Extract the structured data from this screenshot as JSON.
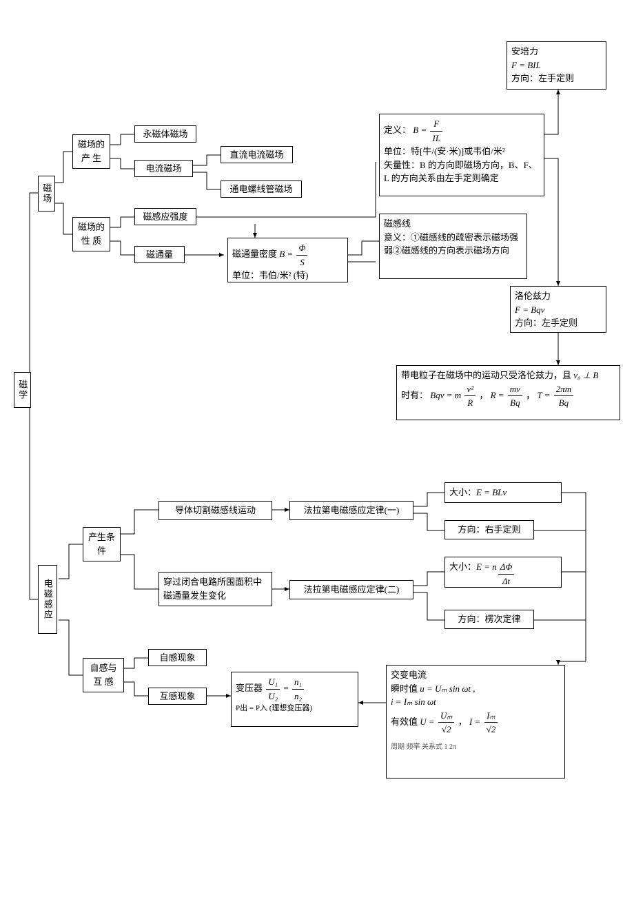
{
  "root": {
    "label": "磁学"
  },
  "magnetism": {
    "label": "磁场",
    "production": {
      "label": "磁场的产 生",
      "permanent": "永磁体磁场",
      "current": "电流磁场",
      "dc": "直流电流磁场",
      "solenoid": "通电螺线管磁场"
    },
    "properties": {
      "label": "磁场的性 质",
      "intensity": "磁感应强度",
      "flux": "磁通量",
      "flux_density": {
        "prefix": "磁通量密度 ",
        "eq_left": "B = ",
        "num": "Φ",
        "den": "S",
        "unit": "单位：韦伯/米² (特)"
      },
      "definition": {
        "prefix": "定义：",
        "eq_left": "B = ",
        "num": "F",
        "den": "IL",
        "unit": "单位：特[牛/(安·米)]或韦伯/米²",
        "vector": "矢量性：B 的方向即磁场方向，B、F、L 的方向关系由左手定则确定"
      },
      "fieldlines": {
        "title": "磁感线",
        "meaning": "意义：①磁感线的疏密表示磁场强弱②磁感线的方向表示磁场方向"
      }
    },
    "ampere": {
      "title": "安培力",
      "eq": "F = BIL",
      "direction": "方向：左手定则"
    },
    "lorentz": {
      "title": "洛伦兹力",
      "eq": "F = Bqv",
      "direction": "方向：左手定则"
    },
    "charged": {
      "prefix": "带电粒子在磁场中的运动只受洛伦兹力，且 ",
      "v0": "v₀ ⊥ B",
      "when": "时有：",
      "eq1_left": "Bqv = m",
      "eq1_num": "v²",
      "eq1_den": "R",
      "eq2_left": "R = ",
      "eq2_num": "mv",
      "eq2_den": "Bq",
      "eq3_left": "T = ",
      "eq3_num": "2πm",
      "eq3_den": "Bq"
    }
  },
  "induction": {
    "label": "电磁感应",
    "conditions": {
      "label": "产生条件",
      "cutting": "导体切割磁感线运动",
      "flux_change": "穿过闭合电路所围面积中磁通量发生变化",
      "faraday1": "法拉第电磁感应定律(一)",
      "faraday2": "法拉第电磁感应定律(二)",
      "mag1": {
        "label": "大小：",
        "eq": "E = BLv"
      },
      "dir1": "方向：右手定则",
      "mag2": {
        "label": "大小：",
        "eq_left": "E = n",
        "num": "ΔΦ",
        "den": "Δt"
      },
      "dir2": "方向：楞次定律"
    },
    "self_mutual": {
      "label": "自感与互 感",
      "self": "自感现象",
      "mutual": "互感现象",
      "transformer": {
        "prefix": "变压器 ",
        "num1": "U₁",
        "den1": "U₂",
        "eq": " = ",
        "num2": "n₁",
        "den2": "n₂",
        "power": "P出 = P入 (理想变压器)"
      }
    },
    "ac": {
      "title": "交变电流",
      "inst_label": "瞬时值  ",
      "inst_u": "u = Uₘ sin ωt ,",
      "inst_i": "i = Iₘ sin ωt",
      "rms_label": "有效值  ",
      "rms_u_left": "U = ",
      "rms_u_num": "Uₘ",
      "rms_u_den": "√2",
      "rms_i_left": "I = ",
      "rms_i_num": "Iₘ",
      "rms_i_den": "√2",
      "bottom": "周期  频率  关系式  1  2π"
    }
  },
  "chart_data": {
    "type": "diagram",
    "description": "Concept map of 磁学 (Magnetism) branching into 磁场 (Magnetic Field) and 电磁感应 (Electromagnetic Induction)",
    "nodes": [
      {
        "id": "root",
        "label": "磁学"
      },
      {
        "id": "field",
        "label": "磁场"
      },
      {
        "id": "field_prod",
        "label": "磁场的产生"
      },
      {
        "id": "permanent",
        "label": "永磁体磁场"
      },
      {
        "id": "current",
        "label": "电流磁场"
      },
      {
        "id": "dc",
        "label": "直流电流磁场"
      },
      {
        "id": "solenoid",
        "label": "通电螺线管磁场"
      },
      {
        "id": "field_prop",
        "label": "磁场的性质"
      },
      {
        "id": "intensity",
        "label": "磁感应强度"
      },
      {
        "id": "flux",
        "label": "磁通量"
      },
      {
        "id": "flux_density",
        "label": "磁通量密度 B=Φ/S 单位:韦伯/米²(特)"
      },
      {
        "id": "definition",
        "label": "定义 B=F/IL 单位:特[牛/(安·米)]或韦伯/米² 矢量性:B的方向即磁场方向,B、F、L的方向关系由左手定则确定"
      },
      {
        "id": "fieldlines",
        "label": "磁感线 意义:①磁感线的疏密表示磁场强弱②磁感线的方向表示磁场方向"
      },
      {
        "id": "ampere",
        "label": "安培力 F=BIL 方向:左手定则"
      },
      {
        "id": "lorentz",
        "label": "洛伦兹力 F=Bqv 方向:左手定则"
      },
      {
        "id": "charged",
        "label": "带电粒子在磁场中的运动只受洛伦兹力,且v₀⊥B时有: Bqv=mv²/R, R=mv/Bq, T=2πm/Bq"
      },
      {
        "id": "induction",
        "label": "电磁感应"
      },
      {
        "id": "conditions",
        "label": "产生条件"
      },
      {
        "id": "cutting",
        "label": "导体切割磁感线运动"
      },
      {
        "id": "faraday1",
        "label": "法拉第电磁感应定律(一)"
      },
      {
        "id": "mag1",
        "label": "大小: E=BLv"
      },
      {
        "id": "dir1",
        "label": "方向:右手定则"
      },
      {
        "id": "flux_change",
        "label": "穿过闭合电路所围面积中磁通量发生变化"
      },
      {
        "id": "faraday2",
        "label": "法拉第电磁感应定律(二)"
      },
      {
        "id": "mag2",
        "label": "大小: E=nΔΦ/Δt"
      },
      {
        "id": "dir2",
        "label": "方向:楞次定律"
      },
      {
        "id": "self_mutual",
        "label": "自感与互感"
      },
      {
        "id": "self",
        "label": "自感现象"
      },
      {
        "id": "mutual",
        "label": "互感现象"
      },
      {
        "id": "transformer",
        "label": "变压器 U₁/U₂=n₁/n₂ P出=P入(理想变压器)"
      },
      {
        "id": "ac",
        "label": "交变电流 瞬时值 u=Uₘsinωt, i=Iₘsinωt 有效值 U=Uₘ/√2, I=Iₘ/√2"
      }
    ],
    "edges": [
      [
        "root",
        "field"
      ],
      [
        "root",
        "induction"
      ],
      [
        "field",
        "field_prod"
      ],
      [
        "field",
        "field_prop"
      ],
      [
        "field_prod",
        "permanent"
      ],
      [
        "field_prod",
        "current"
      ],
      [
        "current",
        "dc"
      ],
      [
        "current",
        "solenoid"
      ],
      [
        "field_prop",
        "intensity"
      ],
      [
        "field_prop",
        "flux"
      ],
      [
        "flux",
        "flux_density"
      ],
      [
        "intensity",
        "flux_density"
      ],
      [
        "intensity",
        "definition"
      ],
      [
        "flux_density",
        "fieldlines"
      ],
      [
        "definition",
        "ampere"
      ],
      [
        "definition",
        "lorentz"
      ],
      [
        "lorentz",
        "charged"
      ],
      [
        "induction",
        "conditions"
      ],
      [
        "induction",
        "self_mutual"
      ],
      [
        "conditions",
        "cutting"
      ],
      [
        "conditions",
        "flux_change"
      ],
      [
        "cutting",
        "faraday1"
      ],
      [
        "faraday1",
        "mag1"
      ],
      [
        "faraday1",
        "dir1"
      ],
      [
        "flux_change",
        "faraday2"
      ],
      [
        "faraday2",
        "mag2"
      ],
      [
        "faraday2",
        "dir2"
      ],
      [
        "self_mutual",
        "self"
      ],
      [
        "self_mutual",
        "mutual"
      ],
      [
        "mutual",
        "transformer"
      ],
      [
        "mag1",
        "ac"
      ],
      [
        "dir1",
        "ac"
      ],
      [
        "mag2",
        "ac"
      ],
      [
        "dir2",
        "ac"
      ],
      [
        "ac",
        "transformer"
      ]
    ]
  }
}
